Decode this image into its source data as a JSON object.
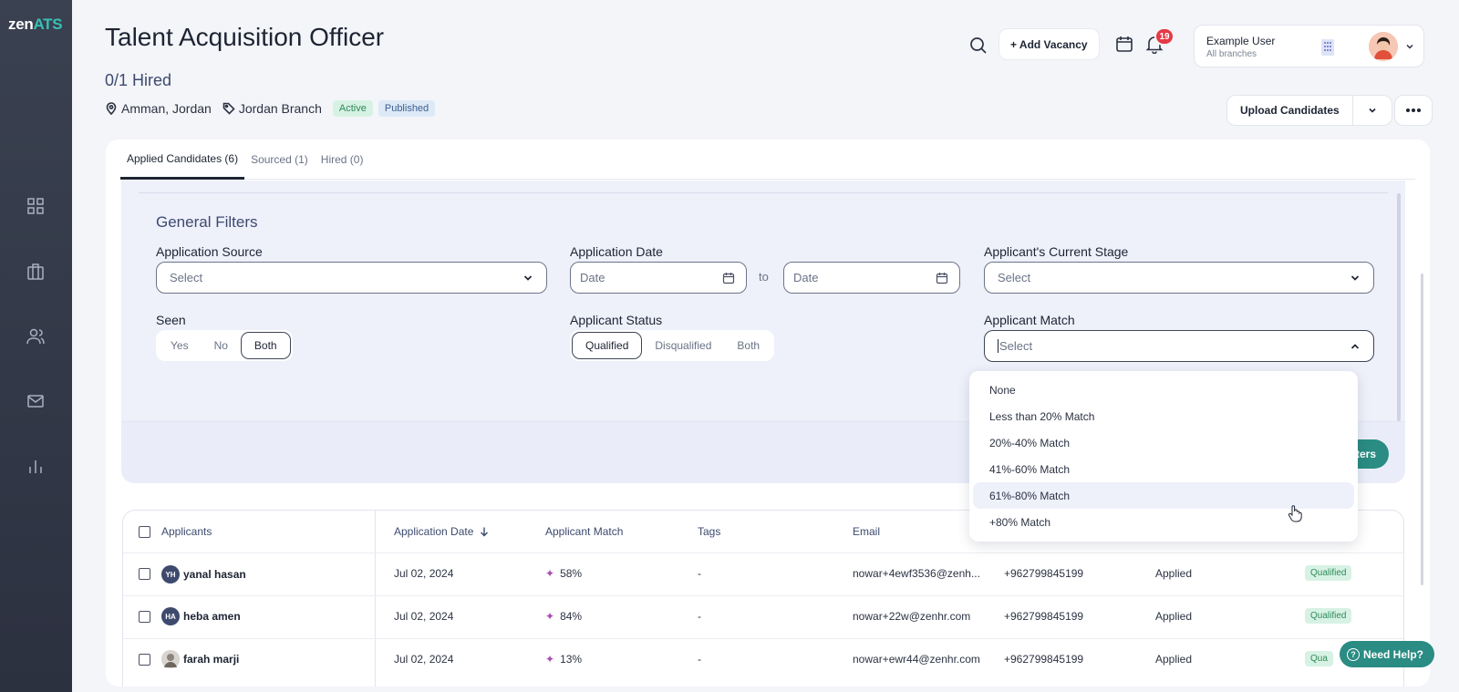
{
  "app": {
    "logo_zen": "zen",
    "logo_ats": "ATS"
  },
  "header": {
    "job_title": "Talent Acquisition Officer",
    "hired": "0/1 Hired",
    "location": "Amman, Jordan",
    "branch": "Jordan Branch",
    "status_active": "Active",
    "status_published": "Published",
    "add_vacancy": "+ Add Vacancy",
    "notifications_count": "19",
    "user_name": "Example User",
    "user_branches": "All branches",
    "upload_candidates": "Upload Candidates"
  },
  "tabs": [
    {
      "label": "Applied Candidates (6)",
      "active": true
    },
    {
      "label": "Sourced (1)",
      "active": false
    },
    {
      "label": "Hired (0)",
      "active": false
    }
  ],
  "filters": {
    "title": "General Filters",
    "application_source": {
      "label": "Application Source",
      "value": "Select"
    },
    "application_date": {
      "label": "Application Date",
      "from_placeholder": "Date",
      "to": "to",
      "to_placeholder": "Date"
    },
    "current_stage": {
      "label": "Applicant's Current Stage",
      "value": "Select"
    },
    "seen": {
      "label": "Seen",
      "options": [
        "Yes",
        "No",
        "Both"
      ],
      "selected": "Both"
    },
    "applicant_status": {
      "label": "Applicant Status",
      "options": [
        "Qualified",
        "Disqualified",
        "Both"
      ],
      "selected": "Qualified"
    },
    "applicant_match": {
      "label": "Applicant Match",
      "value": "Select",
      "options": [
        "None",
        "Less than 20% Match",
        "20%-40% Match",
        "41%-60% Match",
        "61%-80% Match",
        "+80% Match"
      ],
      "hovered": "61%-80% Match"
    },
    "apply_label": "ters"
  },
  "table": {
    "headers": {
      "applicants": "Applicants",
      "application_date": "Application Date",
      "applicant_match": "Applicant Match",
      "tags": "Tags",
      "email": "Email"
    },
    "rows": [
      {
        "initials": "YH",
        "name": "yanal hasan",
        "date": "Jul 02, 2024",
        "match": "58%",
        "tags": "-",
        "email": "nowar+4ewf3536@zenh...",
        "phone": "+962799845199",
        "stage": "Applied",
        "status": "Qualified"
      },
      {
        "initials": "HA",
        "name": "heba amen",
        "date": "Jul 02, 2024",
        "match": "84%",
        "tags": "-",
        "email": "nowar+22w@zenhr.com",
        "phone": "+962799845199",
        "stage": "Applied",
        "status": "Qualified"
      },
      {
        "initials": "",
        "name": "farah marji",
        "date": "Jul 02, 2024",
        "match": "13%",
        "tags": "-",
        "email": "nowar+ewr44@zenhr.com",
        "phone": "+962799845199",
        "stage": "Applied",
        "status": "Qua"
      }
    ]
  },
  "help": {
    "label": "Need Help?"
  },
  "icons": [
    "dashboard-icon",
    "briefcase-icon",
    "users-icon",
    "mail-icon",
    "reports-icon",
    "search-icon",
    "calendar-icon",
    "bell-icon",
    "building-icon",
    "location-icon",
    "tag-icon"
  ],
  "colors": {
    "accent": "#2a8c83",
    "sidebar": "#2c3140",
    "badge_red": "#e53945",
    "match_star": "#a64fae"
  }
}
